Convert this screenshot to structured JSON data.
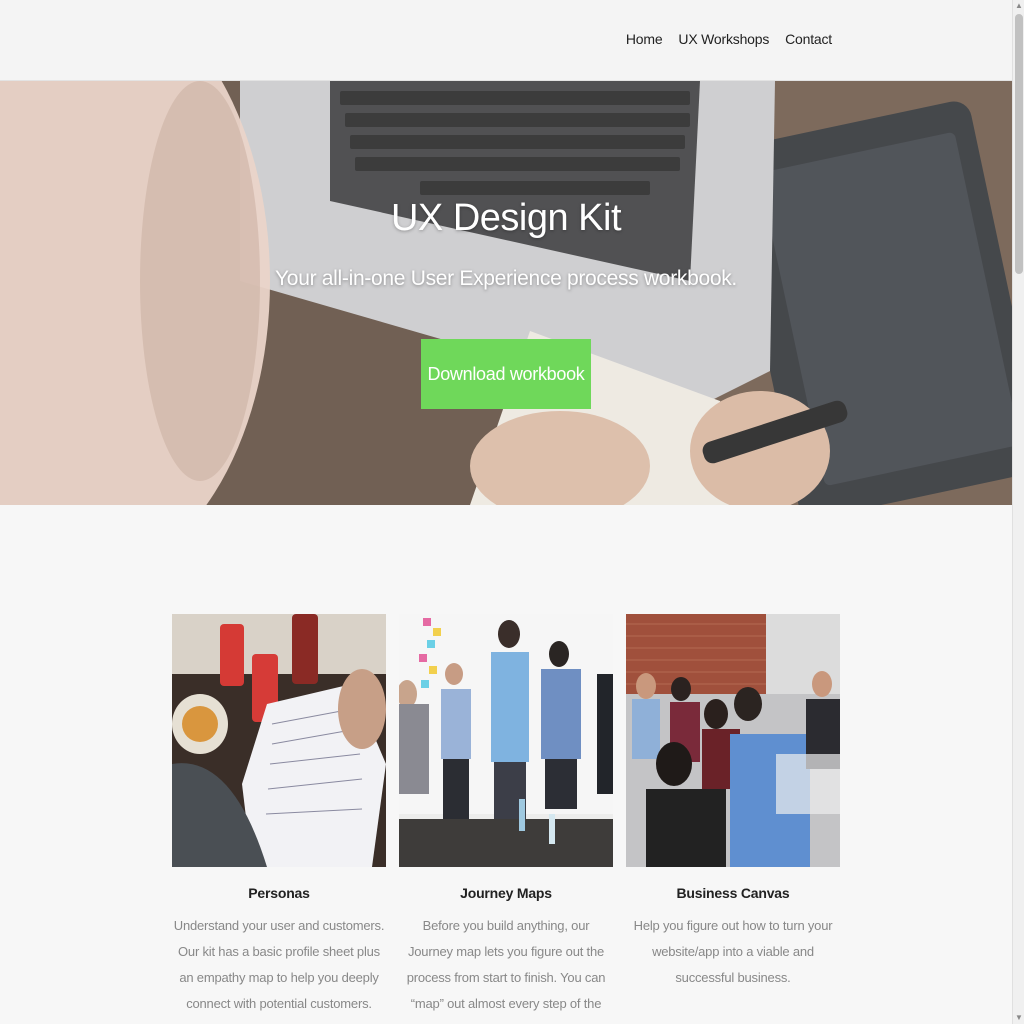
{
  "nav": {
    "items": [
      {
        "label": "Home"
      },
      {
        "label": "UX Workshops"
      },
      {
        "label": "Contact"
      }
    ]
  },
  "hero": {
    "title": "UX Design Kit",
    "subtitle": "Your all-in-one User Experience process workbook.",
    "cta_label": "Download workbook",
    "cta_color": "#6fd85a"
  },
  "features": [
    {
      "title": "Personas",
      "body": "Understand your user and customers. Our kit has a basic profile sheet plus an empathy map to help you deeply connect with potential customers."
    },
    {
      "title": "Journey Maps",
      "body": "Before you build anything, our Journey map lets you figure out the process from start to finish. You can “map” out almost every step of the way to catch dead-ends and remove friction before"
    },
    {
      "title": "Business Canvas",
      "body": "Help you figure out how to turn your website/app into a viable and successful business."
    }
  ]
}
